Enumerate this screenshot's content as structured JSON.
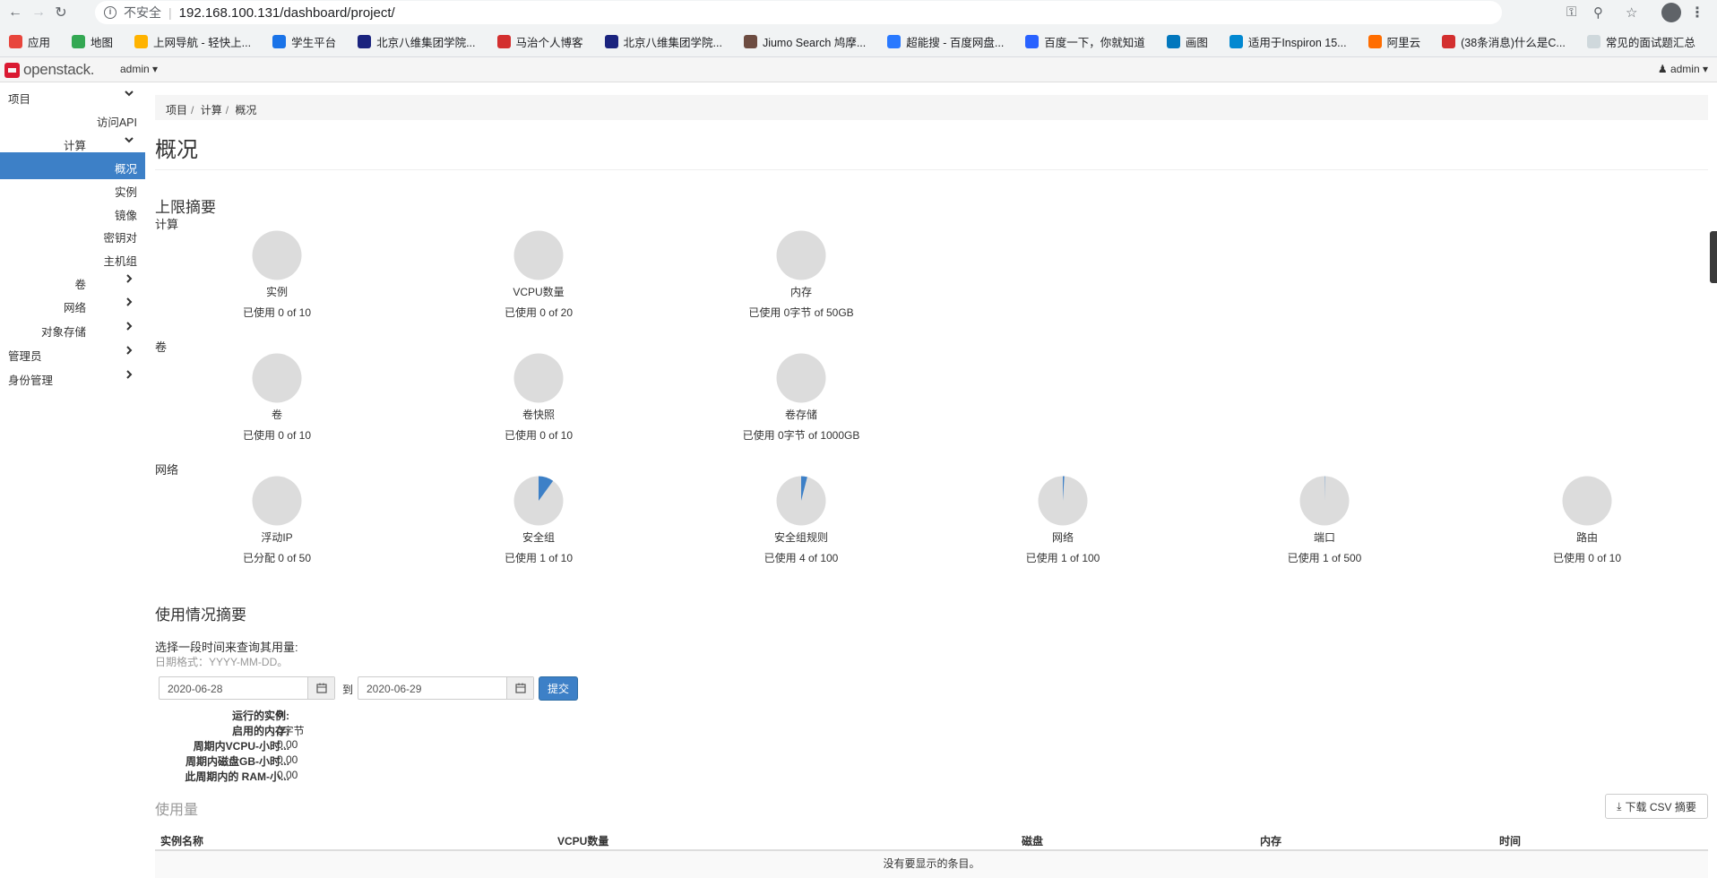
{
  "browser": {
    "insecure_label": "不安全",
    "url": "192.168.100.131/dashboard/project/",
    "bookmarks": [
      {
        "label": "应用",
        "color": "#e8453c"
      },
      {
        "label": "地图",
        "color": "#34a853"
      },
      {
        "label": "上网导航 - 轻快上...",
        "color": "#ffb300"
      },
      {
        "label": "学生平台",
        "color": "#1a73e8"
      },
      {
        "label": "北京八维集团学院...",
        "color": "#1a237e"
      },
      {
        "label": "马治个人博客",
        "color": "#d32f2f"
      },
      {
        "label": "北京八维集团学院...",
        "color": "#1a237e"
      },
      {
        "label": "Jiumo Search 鸠摩...",
        "color": "#6d4c41"
      },
      {
        "label": "超能搜 - 百度网盘...",
        "color": "#2979ff"
      },
      {
        "label": "百度一下，你就知道",
        "color": "#2962ff"
      },
      {
        "label": "画图",
        "color": "#0277bd"
      },
      {
        "label": "适用于Inspiron 15...",
        "color": "#0288d1"
      },
      {
        "label": "阿里云",
        "color": "#ff6d00"
      },
      {
        "label": "(38条消息)什么是C...",
        "color": "#d32f2f"
      },
      {
        "label": "常见的面试题汇总",
        "color": "#cfd8dc"
      }
    ]
  },
  "header": {
    "logo_text": "openstack.",
    "project_menu": "admin ▾",
    "user_menu": "admin ▾"
  },
  "sidebar": {
    "items": [
      {
        "label": "项目",
        "level": 0,
        "chevron": "down"
      },
      {
        "label": "访问API",
        "level": 2,
        "chevron": ""
      },
      {
        "label": "计算",
        "level": 1,
        "chevron": "down"
      },
      {
        "label": "概况",
        "level": 2,
        "chevron": "",
        "active": true
      },
      {
        "label": "实例",
        "level": 2,
        "chevron": ""
      },
      {
        "label": "镜像",
        "level": 2,
        "chevron": ""
      },
      {
        "label": "密钥对",
        "level": 2,
        "chevron": ""
      },
      {
        "label": "主机组",
        "level": 2,
        "chevron": ""
      },
      {
        "label": "卷",
        "level": 1,
        "chevron": "right"
      },
      {
        "label": "网络",
        "level": 1,
        "chevron": "right"
      },
      {
        "label": "对象存储",
        "level": 1,
        "chevron": "right"
      },
      {
        "label": "管理员",
        "level": 0,
        "chevron": "right"
      },
      {
        "label": "身份管理",
        "level": 0,
        "chevron": "right"
      }
    ]
  },
  "breadcrumb": [
    "项目",
    "计算",
    "概况"
  ],
  "page_title": "概况",
  "limit_summary": {
    "title": "上限摘要",
    "groups": [
      {
        "title": "计算",
        "charts": [
          {
            "name": "实例",
            "used_text": "已使用 0 of 10",
            "fraction": 0.0
          },
          {
            "name": "VCPU数量",
            "used_text": "已使用 0 of 20",
            "fraction": 0.0
          },
          {
            "name": "内存",
            "used_text": "已使用 0字节 of 50GB",
            "fraction": 0.0
          }
        ]
      },
      {
        "title": "卷",
        "charts": [
          {
            "name": "卷",
            "used_text": "已使用 0 of 10",
            "fraction": 0.0
          },
          {
            "name": "卷快照",
            "used_text": "已使用 0 of 10",
            "fraction": 0.0
          },
          {
            "name": "卷存储",
            "used_text": "已使用 0字节 of 1000GB",
            "fraction": 0.0
          }
        ]
      },
      {
        "title": "网络",
        "charts": [
          {
            "name": "浮动IP",
            "used_text": "已分配 0 of 50",
            "fraction": 0.0
          },
          {
            "name": "安全组",
            "used_text": "已使用 1 of 10",
            "fraction": 0.1
          },
          {
            "name": "安全组规则",
            "used_text": "已使用 4 of 100",
            "fraction": 0.04
          },
          {
            "name": "网络",
            "used_text": "已使用 1 of 100",
            "fraction": 0.01
          },
          {
            "name": "端口",
            "used_text": "已使用 1 of 500",
            "fraction": 0.002
          },
          {
            "name": "路由",
            "used_text": "已使用 0 of 10",
            "fraction": 0.0
          }
        ]
      }
    ],
    "colors": {
      "empty": "#dcdcdc",
      "used": "#3d80c7"
    }
  },
  "usage_summary": {
    "title": "使用情况摘要",
    "prompt": "选择一段时间来查询其用量:",
    "date_hint": "日期格式：YYYY-MM-DD。",
    "start_date": "2020-06-28",
    "to_label": "到",
    "end_date": "2020-06-29",
    "submit_label": "提交",
    "stats": [
      {
        "key": "运行的实例:",
        "value": "0"
      },
      {
        "key": "启用的内存:",
        "value": "0字节"
      },
      {
        "key": "周期内VCPU-小时...",
        "value": "0.00"
      },
      {
        "key": "周期内磁盘GB-小时...",
        "value": "0.00"
      },
      {
        "key": "此周期内的 RAM-小...",
        "value": "0.00"
      }
    ]
  },
  "usage": {
    "title": "使用量",
    "csv_button": "下载 CSV 摘要",
    "columns": [
      "实例名称",
      "VCPU数量",
      "磁盘",
      "内存",
      "时间"
    ],
    "empty_text": "没有要显示的条目。"
  }
}
